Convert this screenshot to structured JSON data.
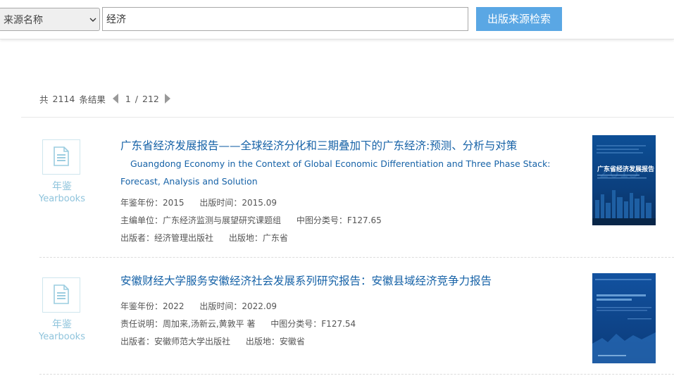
{
  "search": {
    "source_label": "来源名称",
    "query": "经济",
    "button_label": "出版来源检索"
  },
  "results_info": {
    "prefix": "共",
    "total": "2114",
    "suffix": "条结果",
    "current_page": "1",
    "separator": "/",
    "total_pages": "212"
  },
  "results": [
    {
      "type_cn": "年鉴",
      "type_en": "Yearbooks",
      "title": "广东省经济发展报告——全球经济分化和三期叠加下的广东经济:预测、分析与对策",
      "subtitle": "Guangdong Economy in the Context of Global Economic Differentiation and Three Phase Stack: Forecast, Analysis and Solution",
      "meta_lines": [
        [
          "年鉴年份：2015",
          "出版时间：2015.09"
        ],
        [
          "主编单位：广东经济监测与展望研究课题组",
          "中图分类号：F127.65"
        ],
        [
          "出版者：经济管理出版社",
          "出版地：广东省"
        ]
      ],
      "cover_title": "广东省经济发展报告"
    },
    {
      "type_cn": "年鉴",
      "type_en": "Yearbooks",
      "title": "安徽财经大学服务安徽经济社会发展系列研究报告：安徽县域经济竞争力报告",
      "meta_lines": [
        [
          "年鉴年份：2022",
          "出版时间：2022.09"
        ],
        [
          "责任说明：周加来,汤新云,黄敦平 著",
          "中图分类号：F127.54"
        ],
        [
          "出版者：安徽师范大学出版社",
          "出版地：安徽省"
        ]
      ]
    }
  ],
  "colors": {
    "accent": "#5aa7e4",
    "title": "#1662a7",
    "type_label": "#8fc4dc"
  }
}
